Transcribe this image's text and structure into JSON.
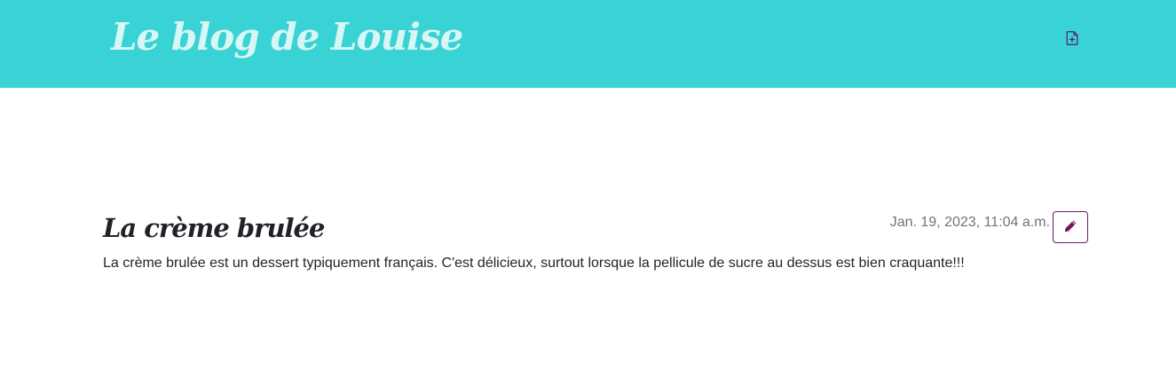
{
  "header": {
    "site_title": "Le blog de Louise",
    "new_post_icon": "file-plus-icon"
  },
  "post": {
    "title": "La crème brulée",
    "date": "Jan. 19, 2023, 11:04 a.m.",
    "edit_icon": "pencil-icon",
    "body": "La crème brulée est un dessert typiquement français. C'est délicieux, surtout lorsque la pellicule de sucre au dessus est bien craquante!!!"
  },
  "colors": {
    "header_background": "#39d3d5",
    "site_title": "#d9f6f6",
    "accent": "#7b1163",
    "date_text": "#6e757c",
    "body_text": "#212529"
  }
}
